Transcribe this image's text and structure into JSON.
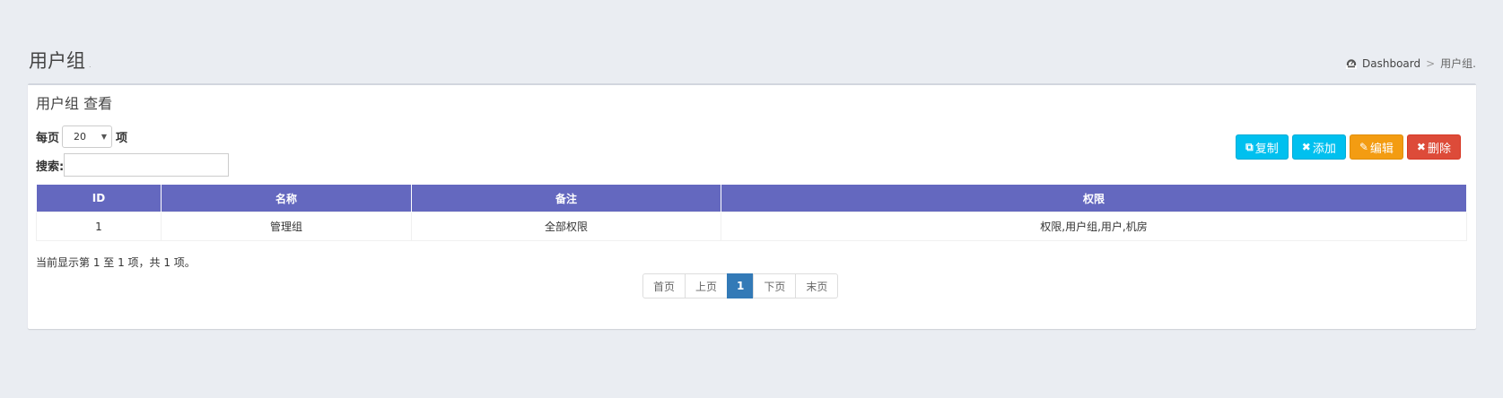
{
  "header": {
    "title": "用户组",
    "subtitle": ".",
    "breadcrumb": {
      "home": "Dashboard",
      "separator": ">",
      "current": "用户组."
    }
  },
  "box": {
    "title": "用户组 查看"
  },
  "controls": {
    "per_page_prefix": "每页",
    "per_page_value": "20",
    "per_page_suffix": "项",
    "search_label": "搜索:",
    "search_value": ""
  },
  "toolbar": {
    "copy_label": "复制",
    "add_label": "添加",
    "edit_label": "编辑",
    "delete_label": "删除"
  },
  "table": {
    "columns": [
      "ID",
      "名称",
      "备注",
      "权限"
    ],
    "rows": [
      [
        "1",
        "管理组",
        "全部权限",
        "权限,用户组,用户,机房"
      ]
    ]
  },
  "footer": {
    "info": "当前显示第 1 至 1 项，共 1 项。"
  },
  "pagination": {
    "first": "首页",
    "prev": "上页",
    "current": "1",
    "next": "下页",
    "last": "末页"
  },
  "colors": {
    "table_header": "#6468bf",
    "info": "#00c0ef",
    "warning": "#f39c12",
    "danger": "#dd4b39",
    "active_page": "#337ab7"
  }
}
